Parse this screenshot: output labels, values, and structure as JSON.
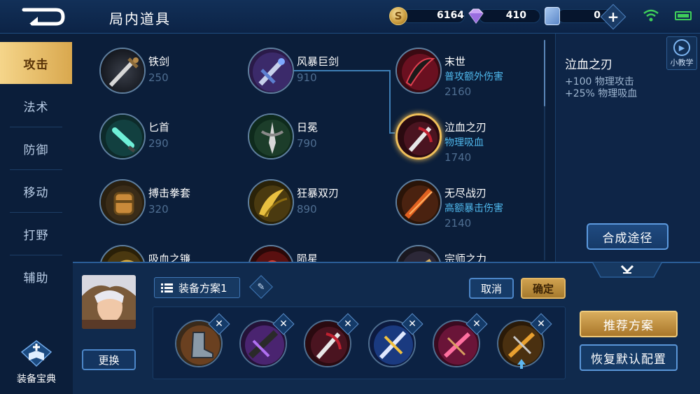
{
  "header": {
    "title": "局内道具",
    "gold": "6164",
    "diamonds": "410",
    "vouchers": "0"
  },
  "nav": {
    "items": [
      "攻击",
      "法术",
      "防御",
      "移动",
      "打野",
      "辅助"
    ],
    "active": "攻击",
    "codex_label": "装备宝典"
  },
  "items": [
    {
      "name": "铁剑",
      "price": "250",
      "desc": ""
    },
    {
      "name": "风暴巨剑",
      "price": "910",
      "desc": ""
    },
    {
      "name": "末世",
      "price": "2160",
      "desc": "普攻额外伤害"
    },
    {
      "name": "匕首",
      "price": "290",
      "desc": ""
    },
    {
      "name": "日冕",
      "price": "790",
      "desc": ""
    },
    {
      "name": "泣血之刃",
      "price": "1740",
      "desc": "物理吸血"
    },
    {
      "name": "搏击拳套",
      "price": "320",
      "desc": ""
    },
    {
      "name": "狂暴双刃",
      "price": "890",
      "desc": ""
    },
    {
      "name": "无尽战刃",
      "price": "2140",
      "desc": "高额暴击伤害"
    },
    {
      "name": "吸血之镰",
      "price": "",
      "desc": ""
    },
    {
      "name": "陨星",
      "price": "",
      "desc": ""
    },
    {
      "name": "宗师之力",
      "price": "",
      "desc": ""
    }
  ],
  "selected_item": "泣血之刃",
  "detail": {
    "title": "泣血之刃",
    "stats": [
      "+100 物理攻击",
      "+25% 物理吸血"
    ],
    "tutorial_label": "小教学",
    "synth_label": "合成途径"
  },
  "bottom": {
    "swap_label": "更换",
    "plan_label": "装备方案1",
    "cancel_label": "取消",
    "confirm_label": "确定",
    "recommend_label": "推荐方案",
    "restore_label": "恢复默认配置",
    "slot_count": 6
  },
  "colors": {
    "accent_gold": "#e2b663",
    "accent_blue": "#4c86c8",
    "desc_blue": "#4fb8ec"
  }
}
